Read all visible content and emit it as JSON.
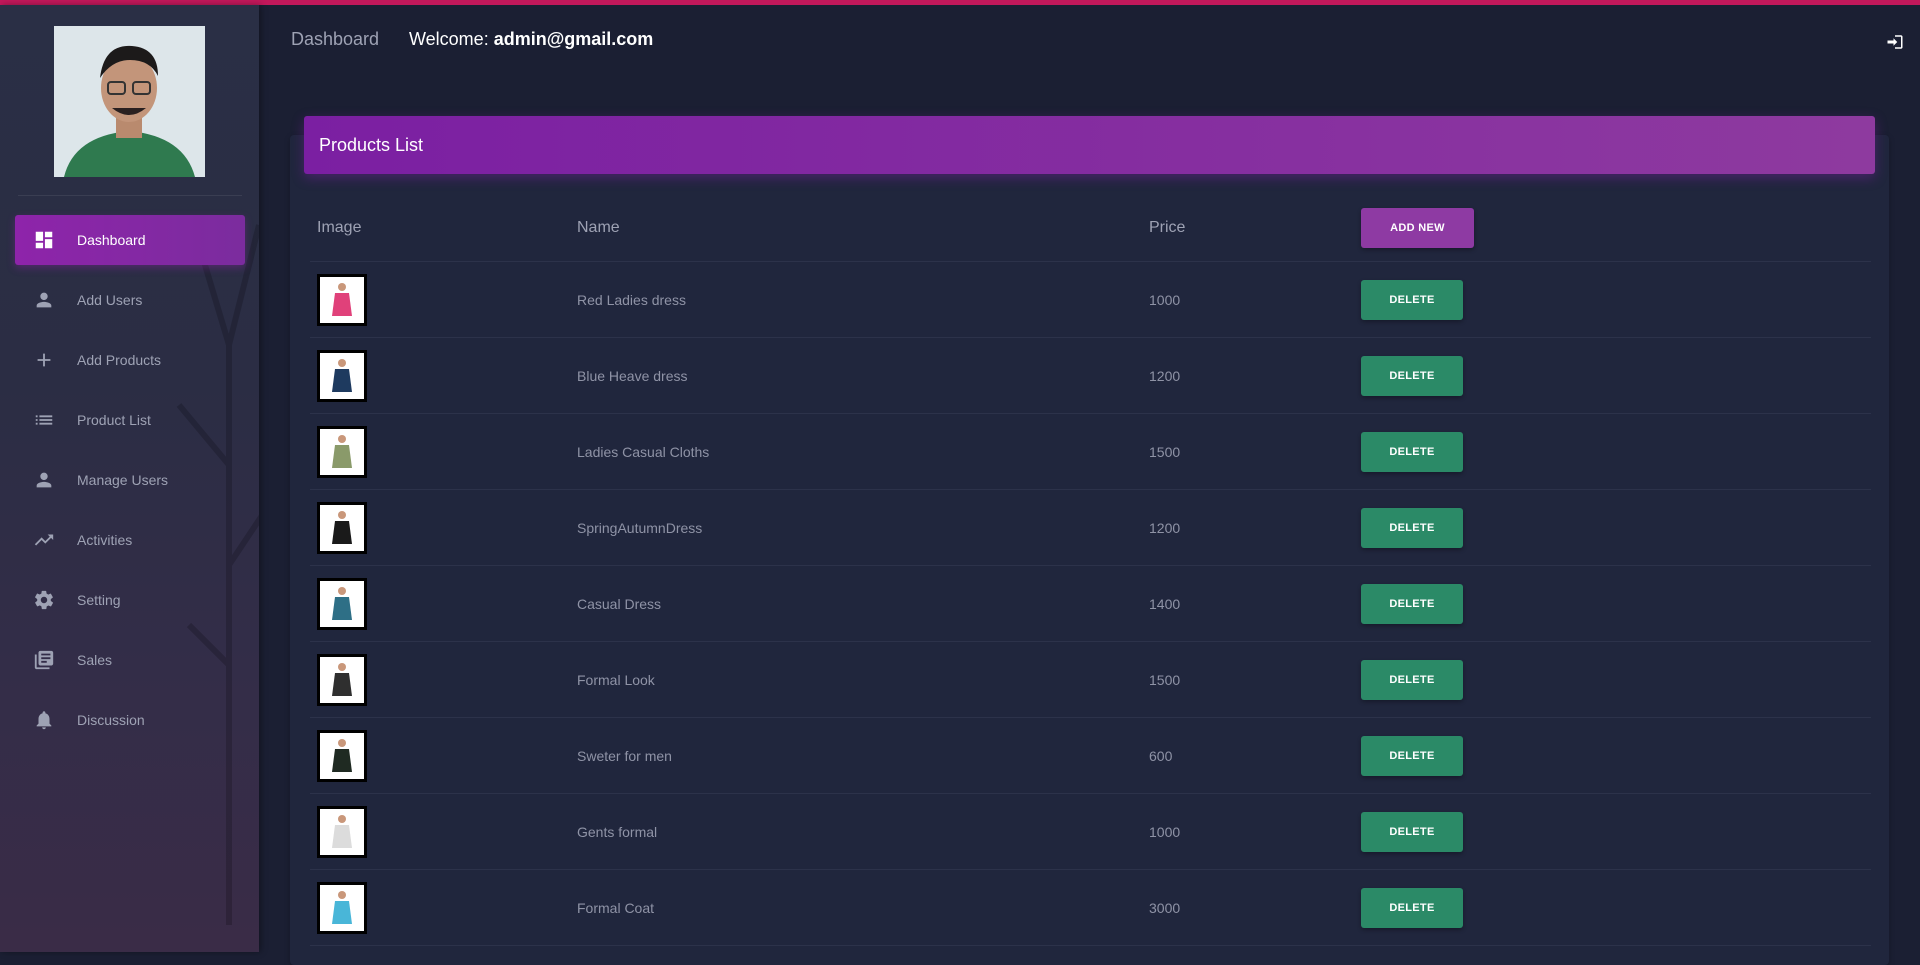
{
  "header": {
    "brand": "Dashboard",
    "welcome_prefix": "Welcome: ",
    "user_email": "admin@gmail.com",
    "logout_icon": "sign-out-icon"
  },
  "sidebar": {
    "items": [
      {
        "label": "Dashboard",
        "icon": "dashboard-icon",
        "active": true
      },
      {
        "label": "Add Users",
        "icon": "person-icon"
      },
      {
        "label": "Add Products",
        "icon": "plus-icon"
      },
      {
        "label": "Product List",
        "icon": "list-icon"
      },
      {
        "label": "Manage Users",
        "icon": "person-icon"
      },
      {
        "label": "Activities",
        "icon": "trending-icon"
      },
      {
        "label": "Setting",
        "icon": "gear-icon"
      },
      {
        "label": "Sales",
        "icon": "library-books-icon"
      },
      {
        "label": "Discussion",
        "icon": "bell-icon"
      }
    ]
  },
  "card": {
    "title": "Products List",
    "columns": {
      "image": "Image",
      "name": "Name",
      "price": "Price"
    },
    "add_button": "ADD NEW",
    "delete_button": "DELETE",
    "rows": [
      {
        "name": "Red Ladies dress",
        "price": "1000",
        "color": "#e0417a"
      },
      {
        "name": "Blue Heave dress",
        "price": "1200",
        "color": "#1e3a5f"
      },
      {
        "name": "Ladies Casual Cloths",
        "price": "1500",
        "color": "#8a9a6a"
      },
      {
        "name": "SpringAutumnDress",
        "price": "1200",
        "color": "#1a1a1a"
      },
      {
        "name": "Casual Dress",
        "price": "1400",
        "color": "#2e6f86"
      },
      {
        "name": "Formal Look",
        "price": "1500",
        "color": "#2f2f2f"
      },
      {
        "name": "Sweter for men",
        "price": "600",
        "color": "#1f2a22"
      },
      {
        "name": "Gents formal",
        "price": "1000",
        "color": "#dcdcdc"
      },
      {
        "name": "Formal Coat",
        "price": "3000",
        "color": "#49b6d8"
      }
    ]
  },
  "colors": {
    "accent": "#8e24aa",
    "delete": "#2b8a67",
    "background": "#1b1f33",
    "top_line": "#c2185b"
  }
}
